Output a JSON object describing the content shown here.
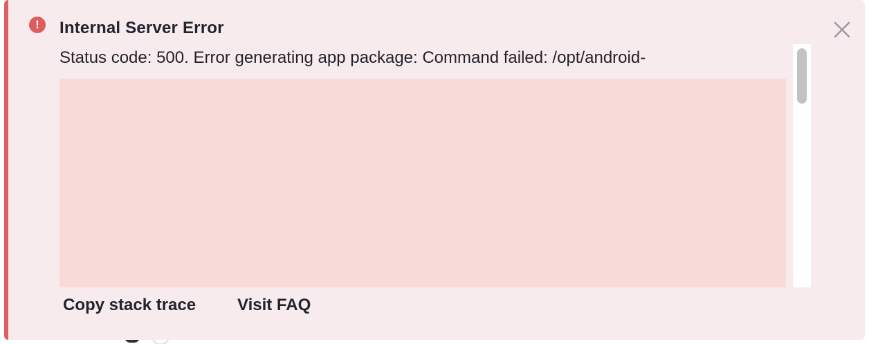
{
  "alert": {
    "title": "Internal Server Error",
    "icon": "error-exclamation-icon",
    "icon_glyph": "!",
    "message": "Status code: 500. Error generating app package:  Command failed: /opt/android-",
    "close_icon": "close-icon",
    "actions": {
      "copy_stack_trace": "Copy stack trace",
      "visit_faq": "Visit FAQ"
    }
  },
  "colors": {
    "alert_background": "#f8ebee",
    "accent_border": "#de5f5f",
    "trace_background": "#f8dbd9",
    "text": "#23232d"
  }
}
